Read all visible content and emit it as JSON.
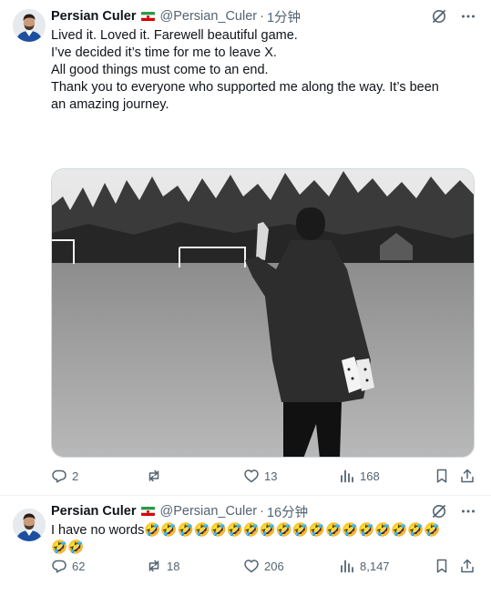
{
  "tweets": [
    {
      "name": "Persian Culer",
      "handle": "@Persian_Culer",
      "time": "1分钟",
      "paragraphs": [
        "Lived it. Loved it. Farewell beautiful game.",
        "I’ve decided it’s time for me to leave X.",
        "All good things must come to an end.",
        "Thank you to everyone who supported me along the way. It’s been an amazing journey."
      ],
      "stats": {
        "replies": "2",
        "reposts": "",
        "likes": "13",
        "views": "168"
      }
    },
    {
      "name": "Persian Culer",
      "handle": "@Persian_Culer",
      "time": "16分钟",
      "text": "I have no words",
      "emoji_run": "🤣🤣🤣🤣🤣🤣🤣🤣🤣🤣🤣🤣🤣🤣🤣🤣🤣🤣🤣🤣",
      "stats": {
        "replies": "62",
        "reposts": "18",
        "likes": "206",
        "views": "8,147"
      }
    }
  ],
  "colors": {
    "text": "#0f1419",
    "secondary": "#536471",
    "border": "#eff3f4"
  },
  "icons": [
    "grok-icon",
    "more-icon",
    "reply-icon",
    "repost-icon",
    "like-icon",
    "views-icon",
    "bookmark-icon",
    "share-icon",
    "flag-iran-icon"
  ]
}
